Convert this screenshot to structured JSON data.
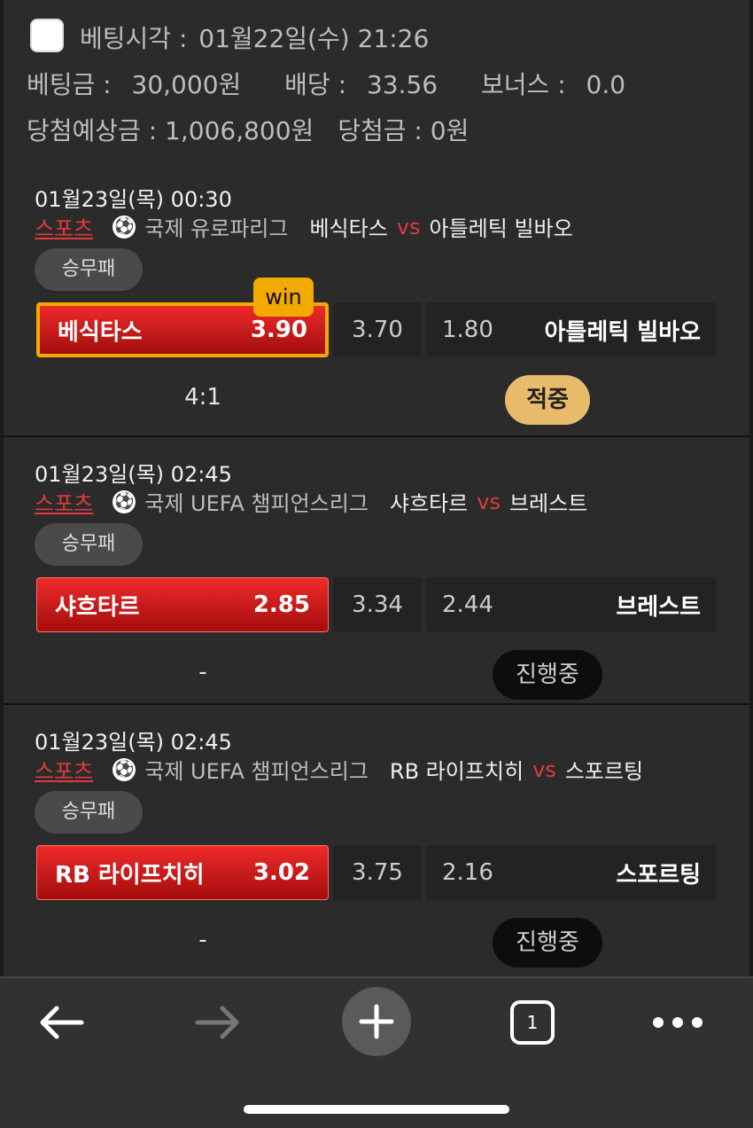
{
  "summary": {
    "bet_time_label": "베팅시각 :",
    "bet_time": "01월22일(수) 21:26",
    "stake_label": "베팅금 :",
    "stake": "30,000원",
    "odds_label": "배당 :",
    "odds": "33.56",
    "bonus_label": "보너스 :",
    "bonus": "0.0",
    "expected_label": "당첨예상금 :",
    "expected": "1,006,800원",
    "won_label": "당첨금 :",
    "won": "0원"
  },
  "bets": [
    {
      "date": "01월23일(목) 00:30",
      "sport": "스포츠",
      "league": "국제 유로파리그",
      "home": "베식타스",
      "vs": "vs",
      "away": "아틀레틱 빌바오",
      "market": "승무패",
      "home_odds": "3.90",
      "draw_odds": "3.70",
      "away_odds": "1.80",
      "win_badge": "win",
      "score": "4:1",
      "status": "적중"
    },
    {
      "date": "01월23일(목) 02:45",
      "sport": "스포츠",
      "league": "국제 UEFA 챔피언스리그",
      "home": "샤흐타르",
      "vs": "vs",
      "away": "브레스트",
      "market": "승무패",
      "home_odds": "2.85",
      "draw_odds": "3.34",
      "away_odds": "2.44",
      "score": "-",
      "status": "진행중"
    },
    {
      "date": "01월23일(목) 02:45",
      "sport": "스포츠",
      "league": "국제 UEFA 챔피언스리그",
      "home": "RB 라이프치히",
      "vs": "vs",
      "away": "스포르팅",
      "market": "승무패",
      "home_odds": "3.02",
      "draw_odds": "3.75",
      "away_odds": "2.16",
      "score": "-",
      "status": "진행중"
    }
  ],
  "browser": {
    "tab_count": "1",
    "icons": [
      "back-arrow-icon",
      "forward-arrow-icon",
      "plus-icon",
      "tabs-icon",
      "more-icon"
    ]
  },
  "colors": {
    "accent_red": "#e23a3a",
    "win_gold": "#f2a900",
    "hit_badge": "#e8bb6a"
  }
}
